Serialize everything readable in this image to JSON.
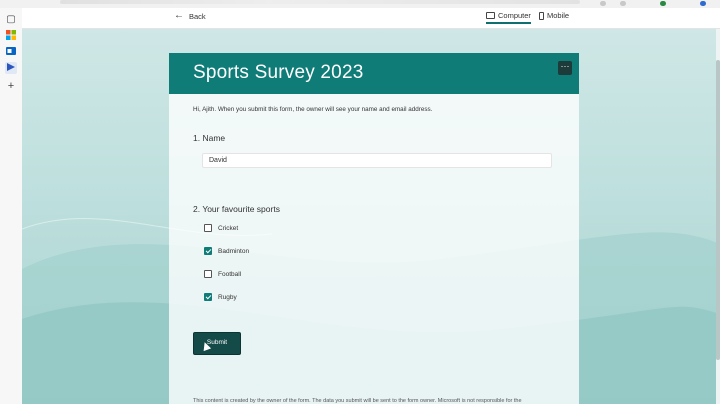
{
  "toolbar": {
    "back_label": "Back",
    "views": [
      {
        "label": "Computer",
        "icon": "monitor-icon",
        "active": true
      },
      {
        "label": "Mobile",
        "icon": "phone-icon",
        "active": false
      }
    ]
  },
  "form": {
    "title": "Sports Survey 2023",
    "more_icon": "ellipsis-icon",
    "intro": "Hi, Ajith. When you submit this form, the owner will see your name and email address.",
    "questions": [
      {
        "number": "1.",
        "title": "Name",
        "answer": "David"
      },
      {
        "number": "2.",
        "title": "Your favourite sports",
        "options": [
          {
            "label": "Cricket",
            "checked": false
          },
          {
            "label": "Badminton",
            "checked": true
          },
          {
            "label": "Football",
            "checked": false
          },
          {
            "label": "Rugby",
            "checked": true
          }
        ]
      }
    ],
    "submit_label": "Submit",
    "footer": "This content is created by the owner of the form. The data you submit will be sent to the form owner. Microsoft is not responsible for the"
  },
  "colors": {
    "accent": "#0f7c78",
    "submit_bg": "#144a48",
    "background": "#bfe0de"
  }
}
